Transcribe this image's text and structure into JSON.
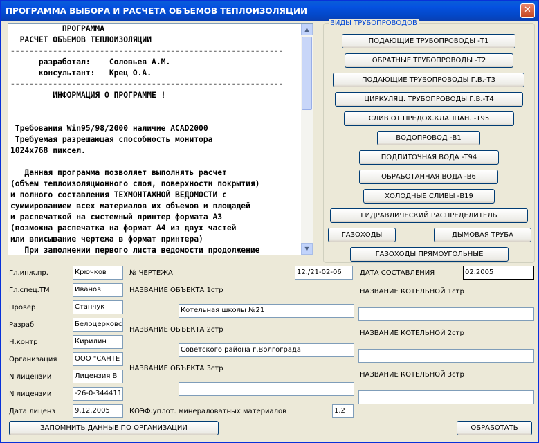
{
  "window": {
    "title": "ПРОГРАММА ВЫБОРА И РАСЧЕТА ОБЪЕМОВ ТЕПЛОИЗОЛЯЦИИ",
    "close_glyph": "✕"
  },
  "info": {
    "text": "           ПРОГРАММА\n  РАСЧЕТ ОБЪЕМОВ ТЕПЛОИЗОЛЯЦИИ\n----------------------------------------------------------\n      разработал:    Соловьев А.М.\n      консультант:   Крец О.А.\n----------------------------------------------------------\n         ИНФОРМАЦИЯ О ПРОГРАММЕ !\n\n\n Требования Win95/98/2000 наличие ACAD2000\n Требуемая разрешающая способность монитора\n1024x768 пиксел.\n\n   Данная программа позволяет выполнять расчет\n(объем теплоизоляционного слоя, поверхности покрытия)\nи полного составления ТЕХМОНТАЖНОЙ ВЕДОМОСТИ с\nсуммированием всех материалов их объемов и площадей\nи распечаткой на системный принтер формата А3\n(возможна распечатка на формат А4 из двух частей\nили вписывание чертежа в формат принтера)\n   При заполнении первого листа ведомости продолжение"
  },
  "pipelines": {
    "title": "ВИДЫ ТРУБОПРОВОДОВ",
    "supply": "ПОДАЮЩИЕ ТРУБОПРОВОДЫ -Т1",
    "return": "ОБРАТНЫЕ ТРУБОПРОВОДЫ -Т2",
    "supply_hw": "ПОДАЮЩИЕ ТРУБОПРОВОДЫ Г.В.-Т3",
    "circ_hw": "ЦИРКУЛЯЦ. ТРУБОПРОВОДЫ Г.В.-Т4",
    "drain_relief": "СЛИВ ОТ ПРЕДОХ.КЛАППАН. -Т95",
    "water": "ВОДОПРОВОД -В1",
    "makeup": "ПОДПИТОЧНАЯ ВОДА -Т94",
    "treated": "ОБРАБОТАННАЯ ВОДА -В6",
    "cold_drain": "ХОЛОДНЫЕ СЛИВЫ -В19",
    "hydraulic": "ГИДРАВЛИЧЕСКИЙ РАСПРЕДЕЛИТЕЛЬ",
    "flues": "ГАЗОХОДЫ",
    "chimney": "ДЫМОВАЯ ТРУБА",
    "rect_flues": "ГАЗОХОДЫ ПРЯМОУГОЛЬНЫЕ"
  },
  "staff": {
    "gl_inzh_label": "Гл.инж.пр.",
    "gl_inzh": "Крючков",
    "gl_spec_label": "Гл.спец.ТМ",
    "gl_spec": "Иванов",
    "prover_label": "Провер",
    "prover": "Станчук",
    "razrab_label": "Разраб",
    "razrab": "Белоцерковс",
    "nkontr_label": "Н.контр",
    "nkontr": "Кирилин",
    "org_label": "Организация",
    "org": "ООО \"САНТЕ",
    "lic1_label": "N лицензии",
    "lic1": "Лицензия В",
    "lic2_label": "N лицензии",
    "lic2": "-26-0-344411",
    "licdate_label": "Дата лиценз",
    "licdate": "9.12.2005"
  },
  "drawing": {
    "num_label": "№ ЧЕРТЕЖА",
    "num": "12./21-02-06",
    "date_label": "ДАТА СОСТАВЛЕНИЯ",
    "date": "02.2005",
    "obj1_label": "НАЗВАНИЕ ОБЪЕКТА 1стр",
    "obj1": "Котельная школы №21",
    "obj2_label": "НАЗВАНИЕ ОБЪЕКТА 2стр",
    "obj2": "Советского района г.Волгограда",
    "obj3_label": "НАЗВАНИЕ ОБЪЕКТА 3стр",
    "obj3": "",
    "boiler1_label": "НАЗВАНИЕ КОТЕЛЬНОЙ 1стр",
    "boiler1": "",
    "boiler2_label": "НАЗВАНИЕ КОТЕЛЬНОЙ 2стр",
    "boiler2": "",
    "boiler3_label": "НАЗВАНИЕ КОТЕЛЬНОЙ 3стр",
    "boiler3": "",
    "coef_label": "КОЭФ.уплот. минераловатных материалов",
    "coef": "1.2"
  },
  "actions": {
    "remember": "ЗАПОМНИТЬ ДАННЫЕ ПО ОРГАНИЗАЦИИ",
    "process": "ОБРАБОТАТЬ"
  },
  "colors": {
    "titlebar": "#0551e0",
    "group_title": "#0046d5",
    "window_bg": "#ece9d8"
  }
}
